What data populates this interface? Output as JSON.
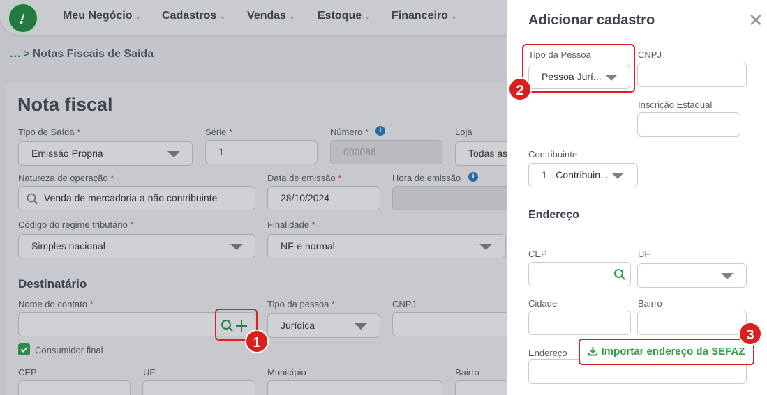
{
  "nav": {
    "items": [
      {
        "label": "Meu Negócio"
      },
      {
        "label": "Cadastros"
      },
      {
        "label": "Vendas"
      },
      {
        "label": "Estoque"
      },
      {
        "label": "Financeiro"
      }
    ],
    "chevron": "⌄"
  },
  "breadcrumb": {
    "ellipsis": "...",
    "separator": ">",
    "current": "Notas Fiscais de Saída"
  },
  "form": {
    "title": "Nota fiscal",
    "tipo_saida": {
      "label": "Tipo de Saída",
      "value": "Emissão Própria"
    },
    "serie": {
      "label": "Série",
      "value": "1"
    },
    "numero": {
      "label": "Número",
      "value": "000086"
    },
    "loja": {
      "label": "Loja",
      "value": "Todas as"
    },
    "natureza": {
      "label": "Natureza de operação",
      "value": "Venda de mercadoria a não contribuinte"
    },
    "data_emissao": {
      "label": "Data de emissão",
      "value": "28/10/2024"
    },
    "hora_emissao": {
      "label": "Hora de emissão",
      "value": ""
    },
    "regime": {
      "label": "Código do regime tributário",
      "value": "Simples nacional"
    },
    "finalidade": {
      "label": "Finalidade",
      "value": "NF-e normal"
    },
    "required_mark": "*",
    "info_glyph": "i"
  },
  "destinatario": {
    "section": "Destinatário",
    "nome_contato": {
      "label": "Nome do contato",
      "value": ""
    },
    "tipo_pessoa": {
      "label": "Tipo da pessoa",
      "value": "Jurídica"
    },
    "cnpj": {
      "label": "CNPJ",
      "value": ""
    },
    "consumidor_final": {
      "label": "Consumidor final",
      "checked": true
    },
    "cep": {
      "label": "CEP"
    },
    "uf": {
      "label": "UF"
    },
    "municipio": {
      "label": "Município"
    },
    "bairro": {
      "label": "Bairro"
    }
  },
  "panel": {
    "title": "Adicionar cadastro",
    "close": "✕",
    "tipo_pessoa": {
      "label": "Tipo da Pessoa",
      "value": "Pessoa Jurí..."
    },
    "cnpj": {
      "label": "CNPJ",
      "value": ""
    },
    "inscricao": {
      "label": "Inscrição Estadual",
      "value": ""
    },
    "contribuinte": {
      "label": "Contribuinte",
      "value": "1 - Contribuin..."
    },
    "endereco_section": "Endereço",
    "cep": {
      "label": "CEP",
      "value": ""
    },
    "uf": {
      "label": "UF",
      "value": ""
    },
    "cidade": {
      "label": "Cidade",
      "value": ""
    },
    "bairro": {
      "label": "Bairro",
      "value": ""
    },
    "endereco": {
      "label": "Endereço",
      "value": ""
    },
    "importar_button": "Importar endereço da SEFAZ"
  },
  "annotations": {
    "step1": "1",
    "step2": "2",
    "step3": "3"
  },
  "colors": {
    "brand_green": "#247a3e",
    "action_green": "#2e9e4a",
    "highlight_red": "#e01e25",
    "info_blue": "#2b6aa8"
  }
}
